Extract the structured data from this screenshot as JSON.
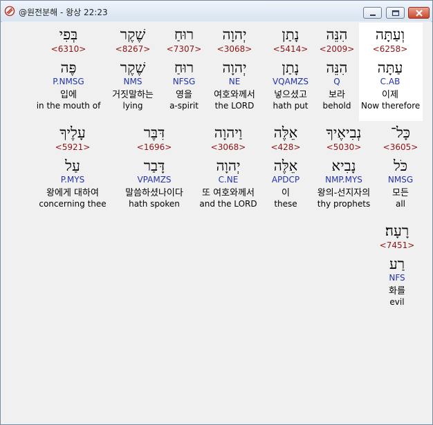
{
  "window": {
    "title": "@원전분해 - 왕상 22:23",
    "icon": "app-emblem-icon"
  },
  "controls": {
    "minimize_icon": "minimize-icon",
    "maximize_icon": "maximize-icon",
    "close_icon": "close-icon"
  },
  "accent": {
    "strong_color": "#8b1414",
    "morph_color": "#2233aa",
    "highlight_bg": "#ffffff"
  },
  "words": [
    {
      "heb": "וְעַתָּה",
      "strong": "<6258>",
      "lemma": "עַתָּה",
      "morph": "C.AB",
      "kor": "이제",
      "eng": "Now therefore",
      "highlighted": true
    },
    {
      "heb": "הִנֵּה",
      "strong": "<2009>",
      "lemma": "הִנֵּה",
      "morph": "Q",
      "kor": "보라",
      "eng": "behold"
    },
    {
      "heb": "נָתַן",
      "strong": "<5414>",
      "lemma": "נָתַן",
      "morph": "VQAMZS",
      "kor": "넣으셨고",
      "eng": "hath put"
    },
    {
      "heb": "יְהוָה",
      "strong": "<3068>",
      "lemma": "יְהוָה",
      "morph": "NE",
      "kor": "여호와께서",
      "eng": "the LORD"
    },
    {
      "heb": "רוּחַ",
      "strong": "<7307>",
      "lemma": "רוּחַ",
      "morph": "NFSG",
      "kor": "영을",
      "eng": "a-spirit"
    },
    {
      "heb": "שֶׁקֶר",
      "strong": "<8267>",
      "lemma": "שֶׁקֶר",
      "morph": "NMS",
      "kor": "거짓말하는",
      "eng": "lying"
    },
    {
      "heb": "בְּפִי",
      "strong": "<6310>",
      "lemma": "פֶּה",
      "morph": "P.NMSG",
      "kor": "입에",
      "eng": "in the mouth of"
    },
    {
      "heb": "כָּל־",
      "strong": "<3605>",
      "lemma": "כֹּל",
      "morph": "NMSG",
      "kor": "모든",
      "eng": "all"
    },
    {
      "heb": "נְבִיאֶיךָ",
      "strong": "<5030>",
      "lemma": "נָבִיא",
      "morph": "NMP.MYS",
      "kor": "왕의-선지자의",
      "eng": "thy prophets"
    },
    {
      "heb": "אֵלֶּה",
      "strong": "<428>",
      "lemma": "אֵלֶּה",
      "morph": "APDCP",
      "kor": "이",
      "eng": "these"
    },
    {
      "heb": "וַיהוָה",
      "strong": "<3068>",
      "lemma": "יְהוָה",
      "morph": "C.NE",
      "kor": "또 여호와께서",
      "eng": "and the LORD"
    },
    {
      "heb": "דִּבֶּר",
      "strong": "<1696>",
      "lemma": "דָּבַר",
      "morph": "VPAMZS",
      "kor": "말씀하셨나이다",
      "eng": "hath spoken"
    },
    {
      "heb": "עָלֶיךָ",
      "strong": "<5921>",
      "lemma": "עַל",
      "morph": "P.MYS",
      "kor": "왕에게 대하여",
      "eng": "concerning thee"
    },
    {
      "heb": "רָעָה׃",
      "strong": "<7451>",
      "lemma": "רַע",
      "morph": "NFS",
      "kor": "화를",
      "eng": "evil"
    }
  ]
}
